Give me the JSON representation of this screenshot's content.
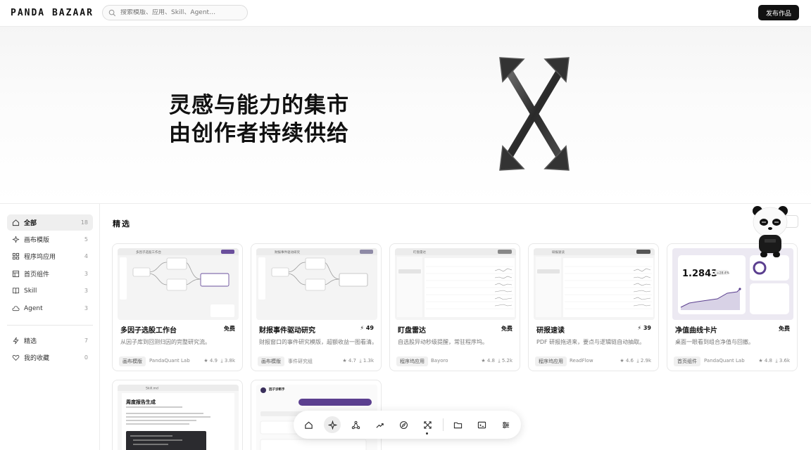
{
  "header": {
    "logo": "PANDA BAZAAR",
    "search_placeholder": "搜索模版、应用、Skill、Agent…",
    "publish_label": "发布作品"
  },
  "hero": {
    "line1": "灵感与能力的集市",
    "line2": "由创作者持续供给"
  },
  "sidebar": {
    "items": [
      {
        "label": "全部",
        "count": "18",
        "icon": "grid-icon"
      },
      {
        "label": "画布模版",
        "count": "5",
        "icon": "sparkle-icon"
      },
      {
        "label": "程序坞应用",
        "count": "4",
        "icon": "apps-icon"
      },
      {
        "label": "首页组件",
        "count": "3",
        "icon": "layout-icon"
      },
      {
        "label": "Skill",
        "count": "3",
        "icon": "book-icon"
      },
      {
        "label": "Agent",
        "count": "3",
        "icon": "cloud-icon"
      }
    ],
    "items2": [
      {
        "label": "精选",
        "count": "7",
        "icon": "bolt-icon"
      },
      {
        "label": "我的收藏",
        "count": "0",
        "icon": "heart-icon"
      }
    ]
  },
  "main": {
    "section_title": "精选",
    "cards": [
      {
        "title": "多因子选股工作台",
        "price": "免费",
        "desc": "从因子库到回测归因的完整研究流。",
        "tag": "画布模版",
        "author": "PandaQuant Lab",
        "rating": "4.9",
        "downloads": "3.8k"
      },
      {
        "title": "财报事件驱动研究",
        "price": "49",
        "desc": "财报窗口的事件研究模版，超额收益一图看清。",
        "tag": "画布模版",
        "author": "事件研究组",
        "rating": "4.7",
        "downloads": "1.3k"
      },
      {
        "title": "盯盘雷达",
        "price": "免费",
        "desc": "自选股异动秒级提醒，常驻程序坞。",
        "tag": "程序坞应用",
        "author": "Bayoro",
        "rating": "4.8",
        "downloads": "5.2k"
      },
      {
        "title": "研报速读",
        "price": "39",
        "desc": "PDF 研报拖进来，要点与逻辑链自动抽取。",
        "tag": "程序坞应用",
        "author": "ReadFlow",
        "rating": "4.6",
        "downloads": "2.9k"
      },
      {
        "title": "净值曲线卡片",
        "price": "免费",
        "desc": "桌面一眼看到组合净值与回撤。",
        "tag": "首页组件",
        "author": "PandaQuant Lab",
        "rating": "4.8",
        "downloads": "3.6k"
      }
    ],
    "preview_texts": {
      "card1_title": "多因子选股工作台",
      "card2_title": "财报事件驱动研究",
      "card3_title": "盯盘雷达",
      "card4_title": "研报速读",
      "card5_value": "1.2843",
      "card5_badge": "+28.4%",
      "card6_skill": "Skill.md",
      "card6_title": "周度报告生成",
      "card7_title": "因子诊断手"
    }
  },
  "dock": {
    "items": [
      "home-icon",
      "sparkle-icon",
      "nodes-icon",
      "chart-icon",
      "compass-icon",
      "expand-icon",
      "folder-icon",
      "terminal-icon",
      "sliders-icon"
    ]
  },
  "colors": {
    "accent": "#5b3f8f",
    "dark": "#111111"
  }
}
